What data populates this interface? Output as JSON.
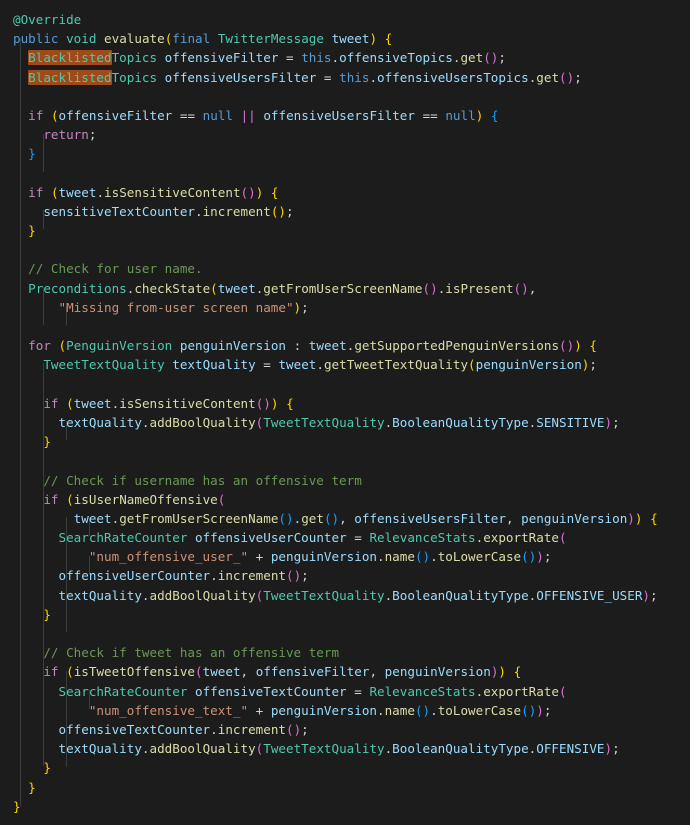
{
  "editor": {
    "background": "#1c1c1c",
    "foreground": "#d4d4d4",
    "language": "java",
    "highlight_color": "#9e4a19",
    "highlighted_term": "Blacklisted",
    "indent_guide_color": "#3d3d3d",
    "palette": {
      "keyword_control": "#c586c0",
      "keyword": "#569cd6",
      "type": "#4ec9b0",
      "variable": "#9cdcfe",
      "function": "#dcdcaa",
      "string": "#ce9178",
      "comment": "#6a9955",
      "bracket_1": "#ffd700",
      "bracket_2": "#da70d6",
      "bracket_3": "#179fff"
    }
  },
  "code": {
    "lines": [
      "@Override",
      "public void evaluate(final TwitterMessage tweet) {",
      "  BlacklistedTopics offensiveFilter = this.offensiveTopics.get();",
      "  BlacklistedTopics offensiveUsersFilter = this.offensiveUsersTopics.get();",
      "",
      "  if (offensiveFilter == null || offensiveUsersFilter == null) {",
      "    return;",
      "  }",
      "",
      "  if (tweet.isSensitiveContent()) {",
      "    sensitiveTextCounter.increment();",
      "  }",
      "",
      "  // Check for user name.",
      "  Preconditions.checkState(tweet.getFromUserScreenName().isPresent(),",
      "      \"Missing from-user screen name\");",
      "",
      "  for (PenguinVersion penguinVersion : tweet.getSupportedPenguinVersions()) {",
      "    TweetTextQuality textQuality = tweet.getTweetTextQuality(penguinVersion);",
      "",
      "    if (tweet.isSensitiveContent()) {",
      "      textQuality.addBoolQuality(TweetTextQuality.BooleanQualityType.SENSITIVE);",
      "    }",
      "",
      "    // Check if username has an offensive term",
      "    if (isUserNameOffensive(",
      "        tweet.getFromUserScreenName().get(), offensiveUsersFilter, penguinVersion)) {",
      "      SearchRateCounter offensiveUserCounter = RelevanceStats.exportRate(",
      "          \"num_offensive_user_\" + penguinVersion.name().toLowerCase());",
      "      offensiveUserCounter.increment();",
      "      textQuality.addBoolQuality(TweetTextQuality.BooleanQualityType.OFFENSIVE_USER);",
      "    }",
      "",
      "    // Check if tweet has an offensive term",
      "    if (isTweetOffensive(tweet, offensiveFilter, penguinVersion)) {",
      "      SearchRateCounter offensiveTextCounter = RelevanceStats.exportRate(",
      "          \"num_offensive_text_\" + penguinVersion.name().toLowerCase());",
      "      offensiveTextCounter.increment();",
      "      textQuality.addBoolQuality(TweetTextQuality.BooleanQualityType.OFFENSIVE);",
      "    }",
      "  }",
      "}"
    ]
  }
}
